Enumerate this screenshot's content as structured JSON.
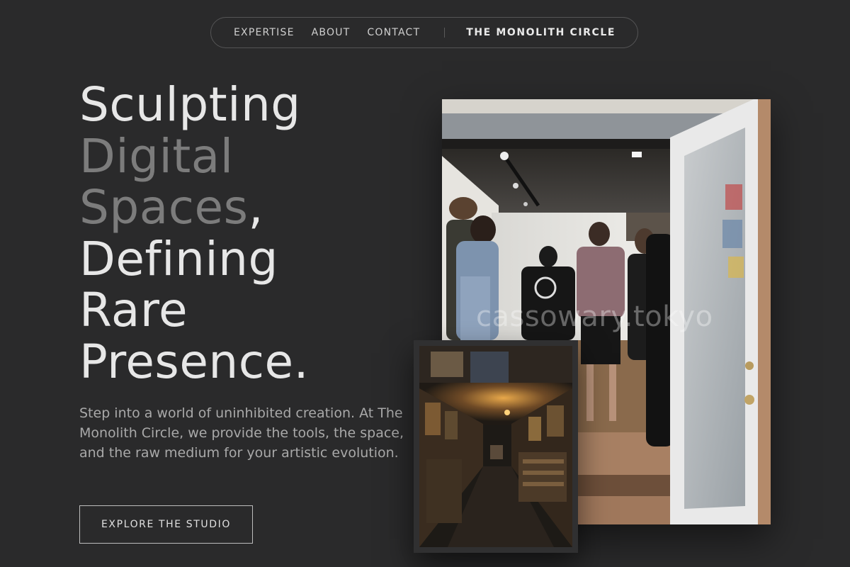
{
  "nav": {
    "links": [
      "EXPERTISE",
      "ABOUT",
      "CONTACT"
    ],
    "brand": "THE MONOLITH CIRCLE"
  },
  "hero": {
    "title_lines": {
      "l1": "Sculpting",
      "l2": "Digital",
      "l3_dim": "Spaces",
      "l3_rest": ",",
      "l4": "Defining",
      "l5": "Rare",
      "l6": "Presence."
    },
    "description": "Step into a world of uninhibited creation. At The Monolith Circle, we provide the tools, the space, and the raw medium for your artistic evolution.",
    "cta_label": "EXPLORE THE STUDIO"
  },
  "images": {
    "main_watermark": "cassowary.tokyo"
  },
  "colors": {
    "background": "#2a2a2b",
    "heading": "#e7e7e7",
    "heading_dim": "#7c7c7c",
    "body_text": "#a9a9a9",
    "nav_border": "#555556"
  }
}
